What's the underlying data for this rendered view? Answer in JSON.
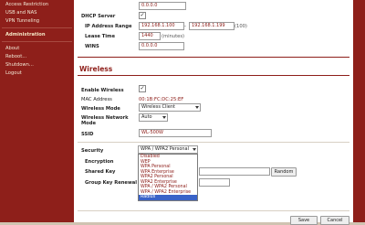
{
  "sidebar": {
    "items": [
      {
        "label": "Access Restriction"
      },
      {
        "label": "USB and NAS"
      },
      {
        "label": "VPN Tunneling"
      },
      {
        "label": "Administration"
      },
      {
        "label": "About"
      },
      {
        "label": "Reboot..."
      },
      {
        "label": "Shutdown..."
      },
      {
        "label": "Logout"
      }
    ]
  },
  "lan": {
    "top_field": "0.0.0.0",
    "dhcp_label": "DHCP Server",
    "dhcp_checked": "✓",
    "ip_range_label": "IP Address Range",
    "ip_start": "192.168.1.100",
    "ip_dash": "-",
    "ip_end": "192.168.1.199",
    "ip_count": "(100)",
    "lease_label": "Lease Time",
    "lease_value": "1440",
    "lease_unit": "(minutes)",
    "wins_label": "WINS",
    "wins_value": "0.0.0.0"
  },
  "wireless": {
    "title": "Wireless",
    "enable_label": "Enable Wireless",
    "enable_checked": "✓",
    "mac_label": "MAC Address",
    "mac_value": "00:1B:FC:DC:25:EF",
    "mode_label": "Wireless Mode",
    "mode_value": "Wireless Client",
    "netmode_label_1": "Wireless Network",
    "netmode_label_2": "Mode",
    "netmode_value": "Auto",
    "ssid_label": "SSID",
    "ssid_value": "WL-500W",
    "security_label": "Security",
    "security_value": "WPA / WPA2 Personal",
    "encryption_label": "Encryption",
    "shared_key_label": "Shared Key",
    "random_button": "Random",
    "group_key_label": "Group Key Renewal",
    "security_options": [
      {
        "label": "Disabled"
      },
      {
        "label": "WEP"
      },
      {
        "label": "WPA Personal"
      },
      {
        "label": "WPA Enterprise"
      },
      {
        "label": "WPA2 Personal"
      },
      {
        "label": "WPA2 Enterprise"
      },
      {
        "label": "WPA / WPA2 Personal"
      },
      {
        "label": "WPA / WPA2 Enterprise"
      },
      {
        "label": "Radius"
      }
    ],
    "security_selected_index": 8
  },
  "footer": {
    "save_label": "Save",
    "cancel_label": "Cancel"
  },
  "colors": {
    "sidebar": "#8e1f1a",
    "panel": "#ffffff",
    "value_text": "#8b1a15",
    "highlight": "#3a63c8"
  }
}
